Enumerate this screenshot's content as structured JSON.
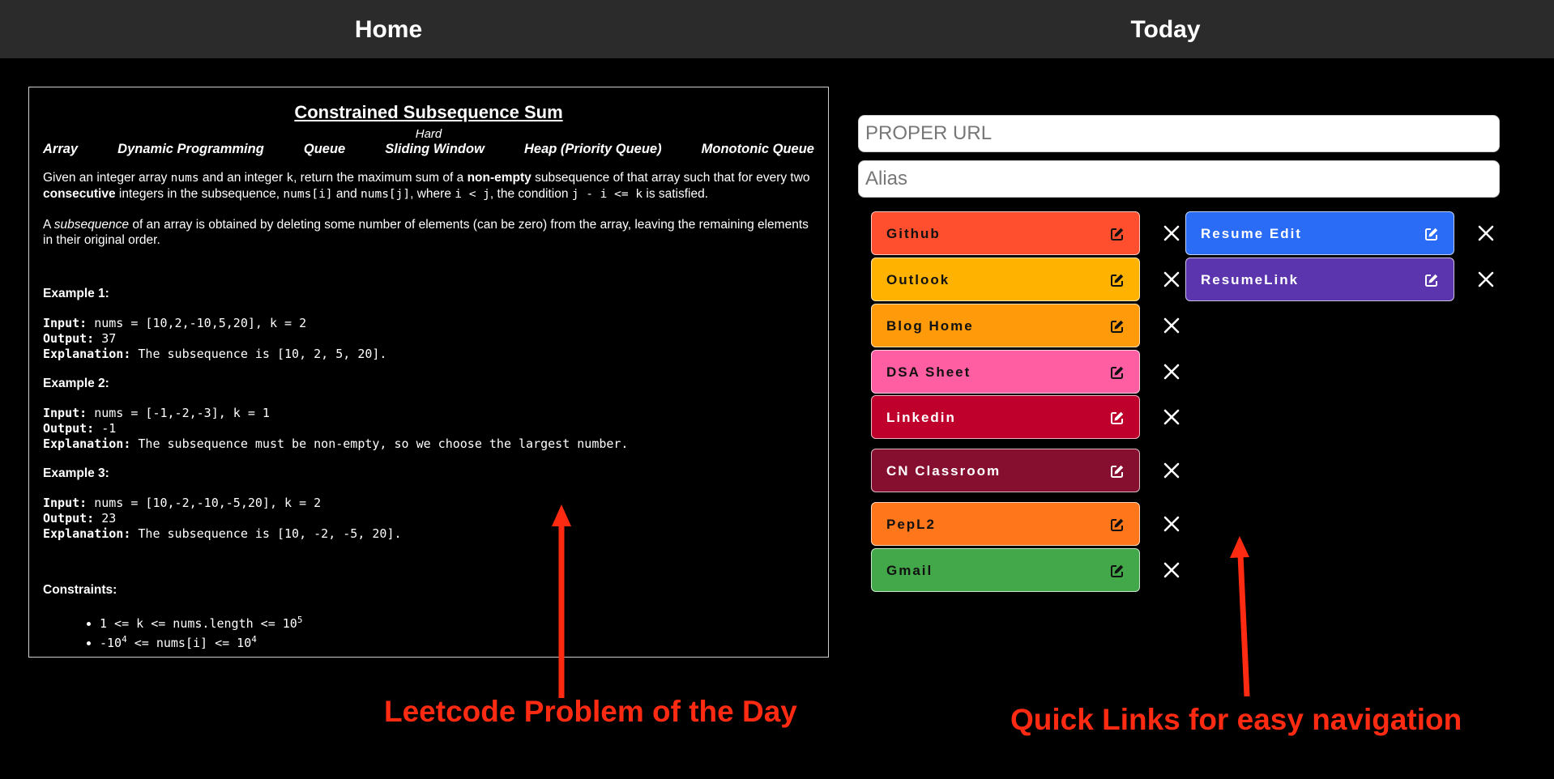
{
  "nav": {
    "home": "Home",
    "today": "Today"
  },
  "problem": {
    "title": "Constrained Subsequence Sum",
    "difficulty": "Hard",
    "tags": [
      "Array",
      "Dynamic Programming",
      "Queue",
      "Sliding Window",
      "Heap (Priority Queue)",
      "Monotonic Queue"
    ],
    "examples": [
      {
        "heading": "Example 1:",
        "input": "nums = [10,2,-10,5,20], k = 2",
        "output": "37",
        "explanation": "The subsequence is [10, 2, 5, 20]."
      },
      {
        "heading": "Example 2:",
        "input": "nums = [-1,-2,-3], k = 1",
        "output": "-1",
        "explanation": "The subsequence must be non-empty, so we choose the largest number."
      },
      {
        "heading": "Example 3:",
        "input": "nums = [10,-2,-10,-5,20], k = 2",
        "output": "23",
        "explanation": "The subsequence is [10, -2, -5, 20]."
      }
    ],
    "labels": {
      "input": "Input:",
      "output": "Output:",
      "explanation": "Explanation:"
    },
    "constraints_heading": "Constraints:"
  },
  "form": {
    "url_placeholder": "PROPER URL",
    "alias_placeholder": "Alias"
  },
  "links": [
    {
      "label": "Github",
      "color": "#ff4f2e",
      "text_color": "#111111"
    },
    {
      "label": "Outlook",
      "color": "#ffb300",
      "text_color": "#111111"
    },
    {
      "label": "Blog Home",
      "color": "#ff9a0a",
      "text_color": "#111111"
    },
    {
      "label": "DSA Sheet",
      "color": "#ff5ea2",
      "text_color": "#111111"
    },
    {
      "label": "Linkedin",
      "color": "#c0002c",
      "text_color": "#ffffff"
    },
    {
      "label": "CN Classroom",
      "color": "#860f30",
      "text_color": "#ffffff"
    },
    {
      "label": "PepL2",
      "color": "#ff771a",
      "text_color": "#111111"
    },
    {
      "label": "Gmail",
      "color": "#43a84a",
      "text_color": "#111111"
    },
    {
      "label": "Resume Edit",
      "color": "#2a6cf6",
      "text_color": "#ffffff"
    },
    {
      "label": "ResumeLink",
      "color": "#5a35ad",
      "text_color": "#ffffff"
    }
  ],
  "annotations": {
    "problem": "Leetcode Problem of the Day",
    "links": "Quick Links for easy navigation"
  }
}
